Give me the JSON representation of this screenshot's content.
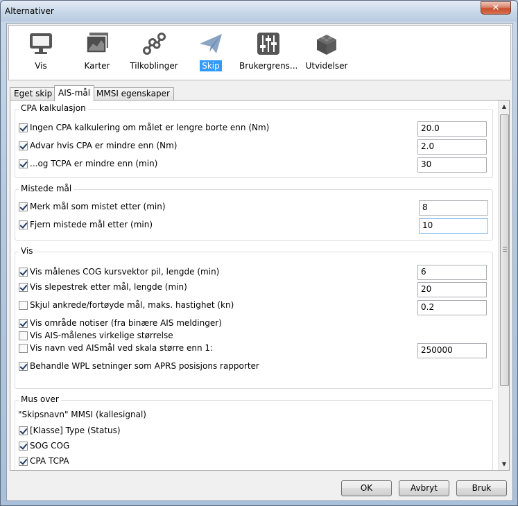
{
  "window": {
    "title": "Alternativer",
    "close_label": "✕"
  },
  "toolbar": {
    "items": [
      {
        "label": "Vis",
        "icon": "monitor-icon"
      },
      {
        "label": "Karter",
        "icon": "charts-icon"
      },
      {
        "label": "Tilkoblinger",
        "icon": "connections-icon"
      },
      {
        "label": "Skip",
        "icon": "ship-paper-plane-icon",
        "active": true
      },
      {
        "label": "Brukergrens...",
        "icon": "sliders-icon"
      },
      {
        "label": "Utvidelser",
        "icon": "plugin-brick-icon"
      }
    ]
  },
  "tabs": [
    {
      "label": "Eget skip"
    },
    {
      "label": "AIS-mål",
      "active": true
    },
    {
      "label": "MMSI egenskaper"
    }
  ],
  "cpa": {
    "title": "CPA kalkulasjon",
    "rows": [
      {
        "label": "Ingen CPA kalkulering om målet er lengre borte enn (Nm)",
        "checked": true,
        "value": "20.0"
      },
      {
        "label": "Advar hvis CPA er mindre enn (Nm)",
        "checked": true,
        "value": "2.0"
      },
      {
        "label": " ...og TCPA er mindre enn (min)",
        "checked": true,
        "value": "30"
      }
    ]
  },
  "lost": {
    "title": "Mistede mål",
    "rows": [
      {
        "label": "Merk mål som mistet etter (min)",
        "checked": true,
        "value": "8"
      },
      {
        "label": "Fjern mistede mål etter (min)",
        "checked": true,
        "value": "10"
      }
    ]
  },
  "vis": {
    "title": "Vis",
    "rows": [
      {
        "label": "Vis målenes COG kursvektor pil, lengde (min)",
        "checked": true,
        "value": "6"
      },
      {
        "label": "Vis slepestrek etter mål, lengde (min)",
        "checked": true,
        "value": "20"
      },
      {
        "label": "Skjul ankrede/fortøyde mål, maks. hastighet (kn)",
        "checked": false,
        "value": "0.2"
      },
      {
        "label": "Vis område notiser (fra binære AIS meldinger)",
        "checked": true
      },
      {
        "label": "Vis AIS-målenes virkelige størrelse",
        "checked": false
      },
      {
        "label": "Vis navn ved AISmål ved skala større enn 1:",
        "checked": false,
        "value": "250000"
      },
      {
        "label": "Behandle WPL setninger som APRS posisjons rapporter",
        "checked": true
      }
    ]
  },
  "mouseover": {
    "title": "Mus over",
    "static_label": "\"Skipsnavn\" MMSI (kallesignal)",
    "rows": [
      {
        "label": "[Klasse] Type (Status)",
        "checked": true
      },
      {
        "label": "SOG COG",
        "checked": true
      },
      {
        "label": "CPA TCPA",
        "checked": true
      }
    ]
  },
  "buttons": {
    "ok": "OK",
    "cancel": "Avbryt",
    "apply": "Bruk"
  }
}
